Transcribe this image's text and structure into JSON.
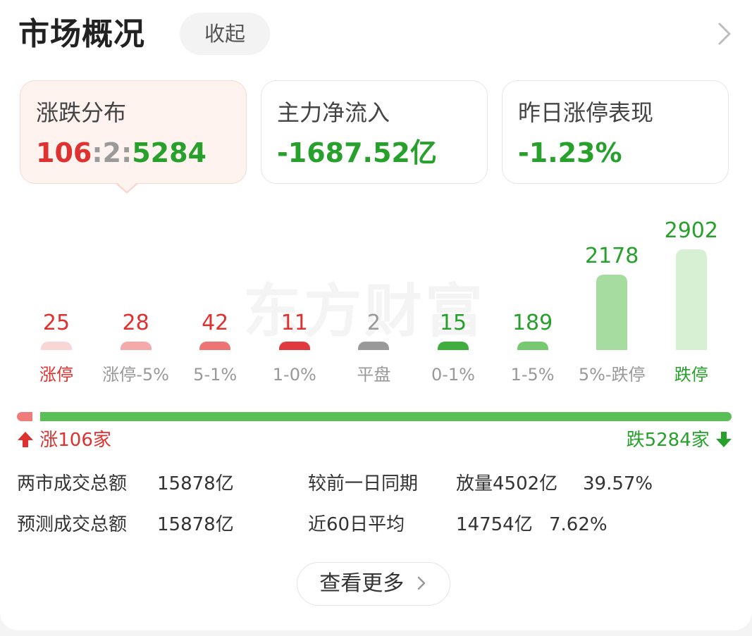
{
  "header": {
    "title": "市场概况",
    "collapse_label": "收起"
  },
  "stats": {
    "distribution": {
      "label": "涨跌分布",
      "up": "106",
      "sep1": ":",
      "flat": "2",
      "sep2": ":",
      "down": "5284"
    },
    "net_inflow": {
      "label": "主力净流入",
      "value": "-1687.52亿"
    },
    "yesterday_limit": {
      "label": "昨日涨停表现",
      "value": "-1.23%"
    }
  },
  "watermark": "东方财富",
  "chart_data": {
    "type": "bar",
    "categories": [
      "涨停",
      "涨停-5%",
      "5-1%",
      "1-0%",
      "平盘",
      "0-1%",
      "1-5%",
      "5%-跌停",
      "跌停"
    ],
    "values": [
      25,
      28,
      42,
      11,
      2,
      15,
      189,
      2178,
      2902
    ],
    "value_labels": [
      "25",
      "28",
      "42",
      "11",
      "2",
      "15",
      "189",
      "2178",
      "2902"
    ],
    "colors": [
      "#f9d6d6",
      "#f4a9ab",
      "#ec7474",
      "#e03a40",
      "#999999",
      "#3fae3c",
      "#77c970",
      "#a6dca0",
      "#d7f0d3"
    ],
    "value_colors": [
      "#e03131",
      "#e03131",
      "#e03131",
      "#e03131",
      "#999999",
      "#27a02c",
      "#27a02c",
      "#27a02c",
      "#27a02c"
    ],
    "label_colors": [
      "#e03131",
      "#999999",
      "#999999",
      "#999999",
      "#999999",
      "#999999",
      "#999999",
      "#999999",
      "#27a02c"
    ]
  },
  "ratio": {
    "up_fraction": 0.0196,
    "rise_text": "涨106家",
    "fall_text": "跌5284家"
  },
  "turnover": {
    "row1": {
      "label": "两市成交总额",
      "value": "15878亿",
      "compare_label": "较前一日同期",
      "change": "放量4502亿",
      "pct": "39.57%"
    },
    "row2": {
      "label": "预测成交总额",
      "value": "15878亿",
      "compare_label": "近60日平均",
      "avg": "14754亿",
      "pct": "7.62%"
    }
  },
  "more_button": {
    "label": "查看更多"
  },
  "accent": {
    "red": "#e03131",
    "green": "#27a02c"
  }
}
